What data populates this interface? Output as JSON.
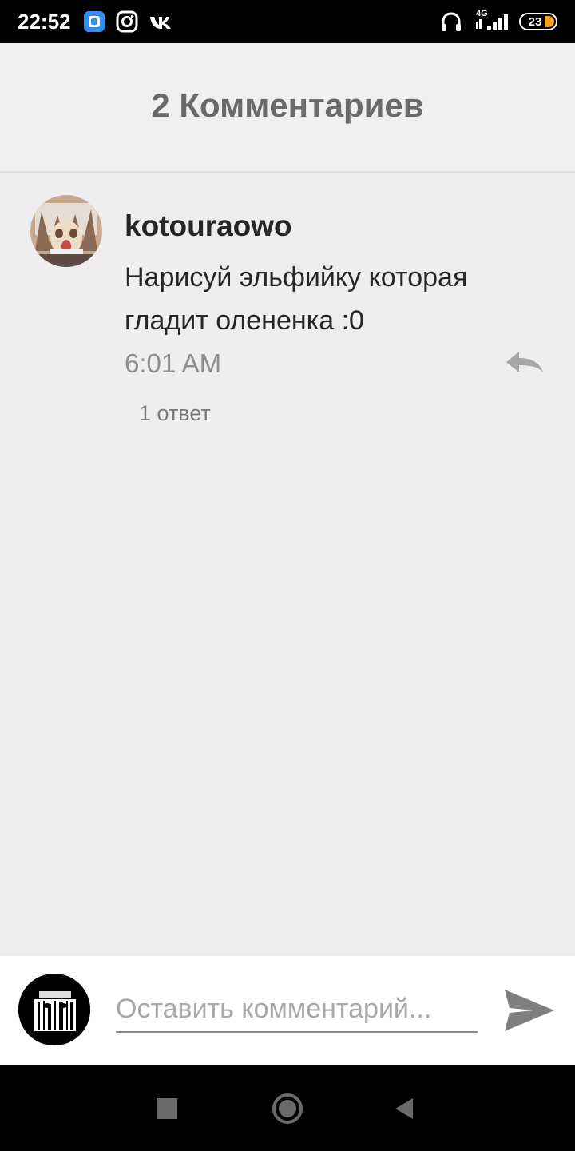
{
  "status_bar": {
    "time": "22:52",
    "network": "4G",
    "battery": "23",
    "apps": [
      "app-icon",
      "instagram-icon",
      "vk-icon"
    ]
  },
  "header": {
    "title": "2 Комментариев"
  },
  "comment": {
    "author": "kotouraowo",
    "text": "Нарисуй эльфийку которая гладит олененка :0",
    "time": "6:01 AM",
    "replies": "1 ответ"
  },
  "composer": {
    "placeholder": "Оставить комментарий..."
  },
  "colors": {
    "background": "#efedef",
    "header_text": "#6a6a6a",
    "battery": "#f4a51c"
  }
}
